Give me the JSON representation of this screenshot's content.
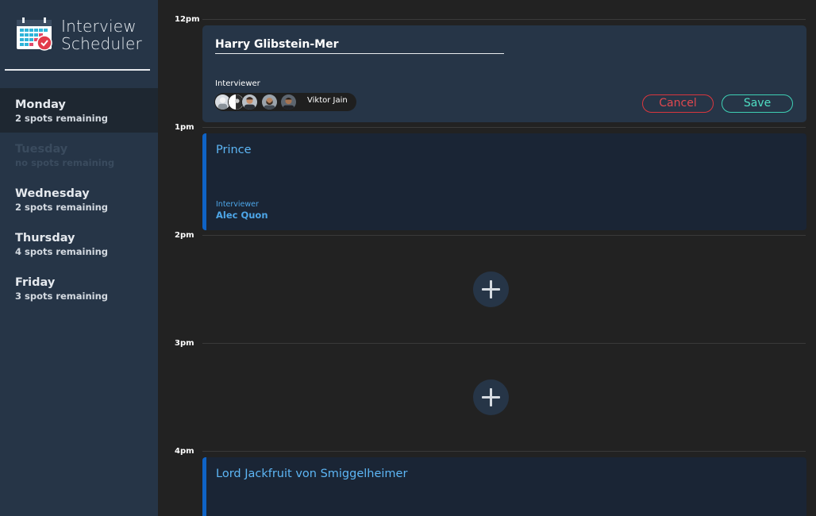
{
  "app": {
    "title_line1": "Interview",
    "title_line2": "Scheduler",
    "logo_icon": "calendar-check-icon"
  },
  "days": [
    {
      "name": "Monday",
      "spots": "2 spots remaining",
      "state": "active"
    },
    {
      "name": "Tuesday",
      "spots": "no spots remaining",
      "state": "disabled"
    },
    {
      "name": "Wednesday",
      "spots": "2 spots remaining",
      "state": "normal"
    },
    {
      "name": "Thursday",
      "spots": "4 spots remaining",
      "state": "normal"
    },
    {
      "name": "Friday",
      "spots": "3 spots remaining",
      "state": "normal"
    }
  ],
  "times": [
    "12pm",
    "1pm",
    "2pm",
    "3pm",
    "4pm"
  ],
  "edit_appointment": {
    "student_name": "Harry Glibstein-Mer",
    "interviewer_label": "Interviewer",
    "selected_interviewer": "Viktor Jain",
    "cancel_label": "Cancel",
    "save_label": "Save"
  },
  "appointments": [
    {
      "student": "Prince",
      "interviewer_label": "Interviewer",
      "interviewer": "Alec Quon"
    },
    {
      "student": "Lord Jackfruit von Smiggelheimer"
    }
  ],
  "colors": {
    "sidebar_bg": "#263547",
    "active_day_bg": "#1e2731",
    "booked_accent": "#0f63c6",
    "booked_text": "#5db6f5",
    "cancel": "#e0484f",
    "save": "#4fdec3"
  }
}
